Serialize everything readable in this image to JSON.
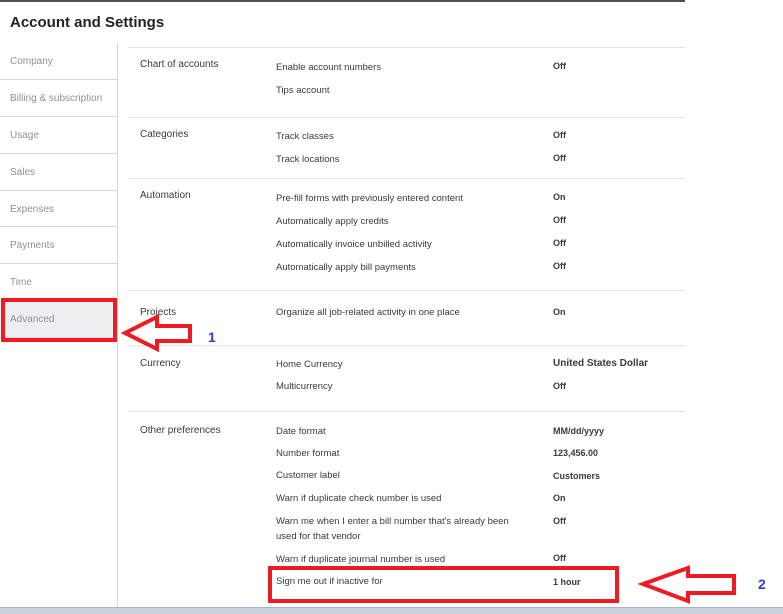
{
  "title": "Account and Settings",
  "sidebar": {
    "items": [
      {
        "label": "Company"
      },
      {
        "label": "Billing & subscription"
      },
      {
        "label": "Usage"
      },
      {
        "label": "Sales"
      },
      {
        "label": "Expenses"
      },
      {
        "label": "Payments"
      },
      {
        "label": "Time"
      },
      {
        "label": "Advanced",
        "active": true
      }
    ]
  },
  "sections": [
    {
      "title": "Chart of accounts",
      "rows": [
        {
          "label": "Enable account numbers",
          "value": "Off"
        },
        {
          "label": "Tips account",
          "value": ""
        }
      ]
    },
    {
      "title": "Categories",
      "rows": [
        {
          "label": "Track classes",
          "value": "Off"
        },
        {
          "label": "Track locations",
          "value": "Off"
        }
      ]
    },
    {
      "title": "Automation",
      "rows": [
        {
          "label": "Pre-fill forms with previously entered content",
          "value": "On"
        },
        {
          "label": "Automatically apply credits",
          "value": "Off"
        },
        {
          "label": "Automatically invoice unbilled activity",
          "value": "Off"
        },
        {
          "label": "Automatically apply bill payments",
          "value": "Off"
        }
      ]
    },
    {
      "title": "Projects",
      "rows": [
        {
          "label": "Organize all job-related activity in one place",
          "value": "On"
        }
      ]
    },
    {
      "title": "Currency",
      "rows": [
        {
          "label": "Home Currency",
          "value": "United States Dollar"
        },
        {
          "label": "Multicurrency",
          "value": "Off"
        }
      ]
    },
    {
      "title": "Other preferences",
      "rows": [
        {
          "label": "Date format",
          "value": "MM/dd/yyyy"
        },
        {
          "label": "Number format",
          "value": "123,456.00"
        },
        {
          "label": "Customer label",
          "value": "Customers"
        },
        {
          "label": "Warn if duplicate check number is used",
          "value": "On"
        },
        {
          "label": "Warn me when I enter a bill number that's already been used for that vendor",
          "value": "Off"
        },
        {
          "label": "Warn if duplicate journal number is used",
          "value": "Off"
        },
        {
          "label": "Sign me out if inactive for",
          "value": "1 hour"
        }
      ]
    }
  ],
  "annotations": {
    "step1": "1",
    "step2": "2",
    "color": "#ed1c24"
  }
}
